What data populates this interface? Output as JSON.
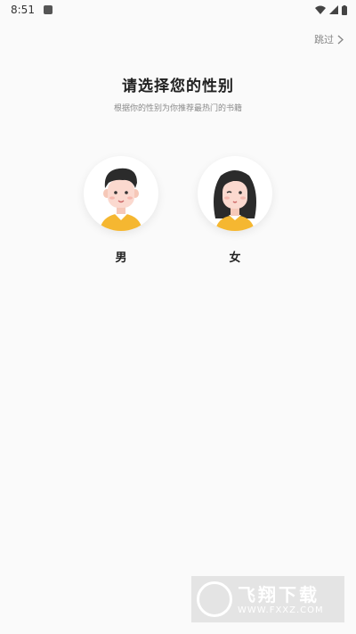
{
  "status_bar": {
    "time": "8:51"
  },
  "header": {
    "skip_label": "跳过"
  },
  "main": {
    "title": "请选择您的性别",
    "subtitle": "根据你的性别为你推荐最热门的书籍",
    "options": [
      {
        "label": "男",
        "icon": "male-avatar-icon"
      },
      {
        "label": "女",
        "icon": "female-avatar-icon"
      }
    ]
  },
  "watermark": {
    "title": "飞翔下载",
    "url": "WWW.FXXZ.COM"
  },
  "colors": {
    "background": "#fafafa",
    "accent_yellow": "#f5b731",
    "hair": "#2b2b2b",
    "skin": "#fbd9cf"
  }
}
